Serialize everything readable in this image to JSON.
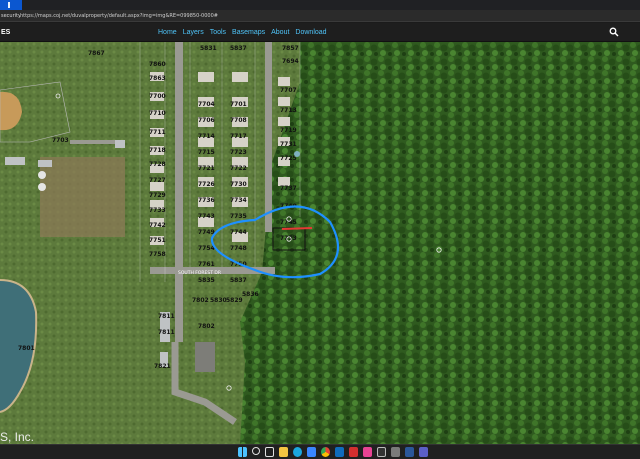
{
  "browser": {
    "security_label": "security",
    "url": "https://maps.coj.net/duvalproperty/default.aspx?img=img&RE=099850-0000#"
  },
  "site": {
    "brand": "ES",
    "menu": [
      "Home",
      "Layers",
      "Tools",
      "Basemaps",
      "About",
      "Download"
    ],
    "search_icon": "search-icon"
  },
  "map": {
    "copyright": "S, Inc.",
    "parcels": [
      "7867",
      "5831",
      "5837",
      "7857",
      "7860",
      "7863",
      "7694",
      "7700",
      "7704",
      "7701",
      "7707",
      "7710",
      "7706",
      "7708",
      "7711",
      "7714",
      "7713",
      "7717",
      "7715",
      "7718",
      "7719",
      "7721",
      "7723",
      "7722",
      "7725",
      "7703",
      "7728",
      "7726",
      "7727",
      "7731",
      "7729",
      "7730",
      "7734",
      "7737",
      "7736",
      "7733",
      "7735",
      "7740",
      "7749",
      "7744",
      "7742",
      "7743",
      "7748",
      "7751",
      "7745",
      "7754",
      "7758",
      "7753",
      "7750",
      "7761",
      "5835",
      "5837",
      "7802",
      "5830",
      "5829",
      "7811",
      "7811",
      "7821",
      "7801",
      "7802",
      "5836"
    ],
    "street_label": "SOUTH FOREST DR",
    "boundary_color": "#1e90ff",
    "marker_color": "#e53935"
  },
  "taskbar": {
    "icons": [
      "windows-icon",
      "search-icon",
      "task-view-icon",
      "files-icon",
      "edge-icon",
      "store-icon",
      "chrome-icon",
      "mail-icon",
      "red-app-icon",
      "music-icon",
      "clock-icon",
      "settings-icon",
      "word-icon",
      "teams-icon"
    ]
  }
}
